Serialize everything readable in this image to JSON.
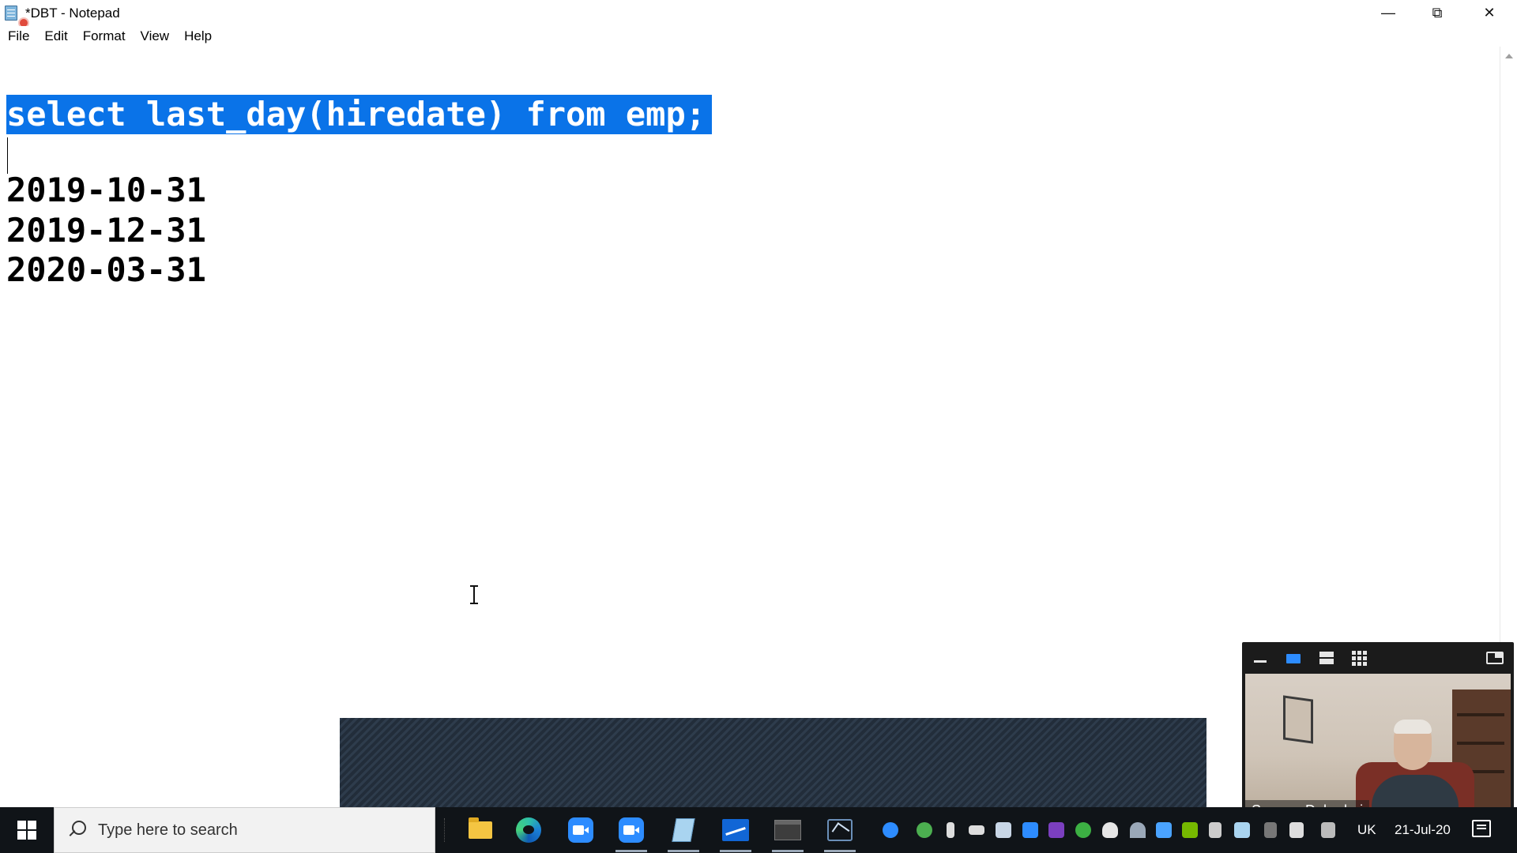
{
  "window": {
    "title": "*DBT - Notepad"
  },
  "menu": {
    "items": [
      "File",
      "Edit",
      "Format",
      "View",
      "Help"
    ]
  },
  "editor": {
    "selected_line": "select last_day(hiredate) from emp;",
    "lines": [
      "2019-10-31",
      "2019-12-31",
      "2020-03-31"
    ]
  },
  "video": {
    "participant_name": "Sameer Dehadrai"
  },
  "taskbar": {
    "search_placeholder": "Type here to search",
    "pinned_apps": [
      "File Explorer",
      "Microsoft Edge",
      "Zoom",
      "Zoom Meetings",
      "Notepad",
      "Chart app",
      "SQL Shell",
      "MySQL Workbench"
    ],
    "language": "UK",
    "date": "21-Jul-20"
  },
  "colors": {
    "selection": "#0a73e8",
    "taskbar": "#101418",
    "zoom_blue": "#2d8cff"
  }
}
